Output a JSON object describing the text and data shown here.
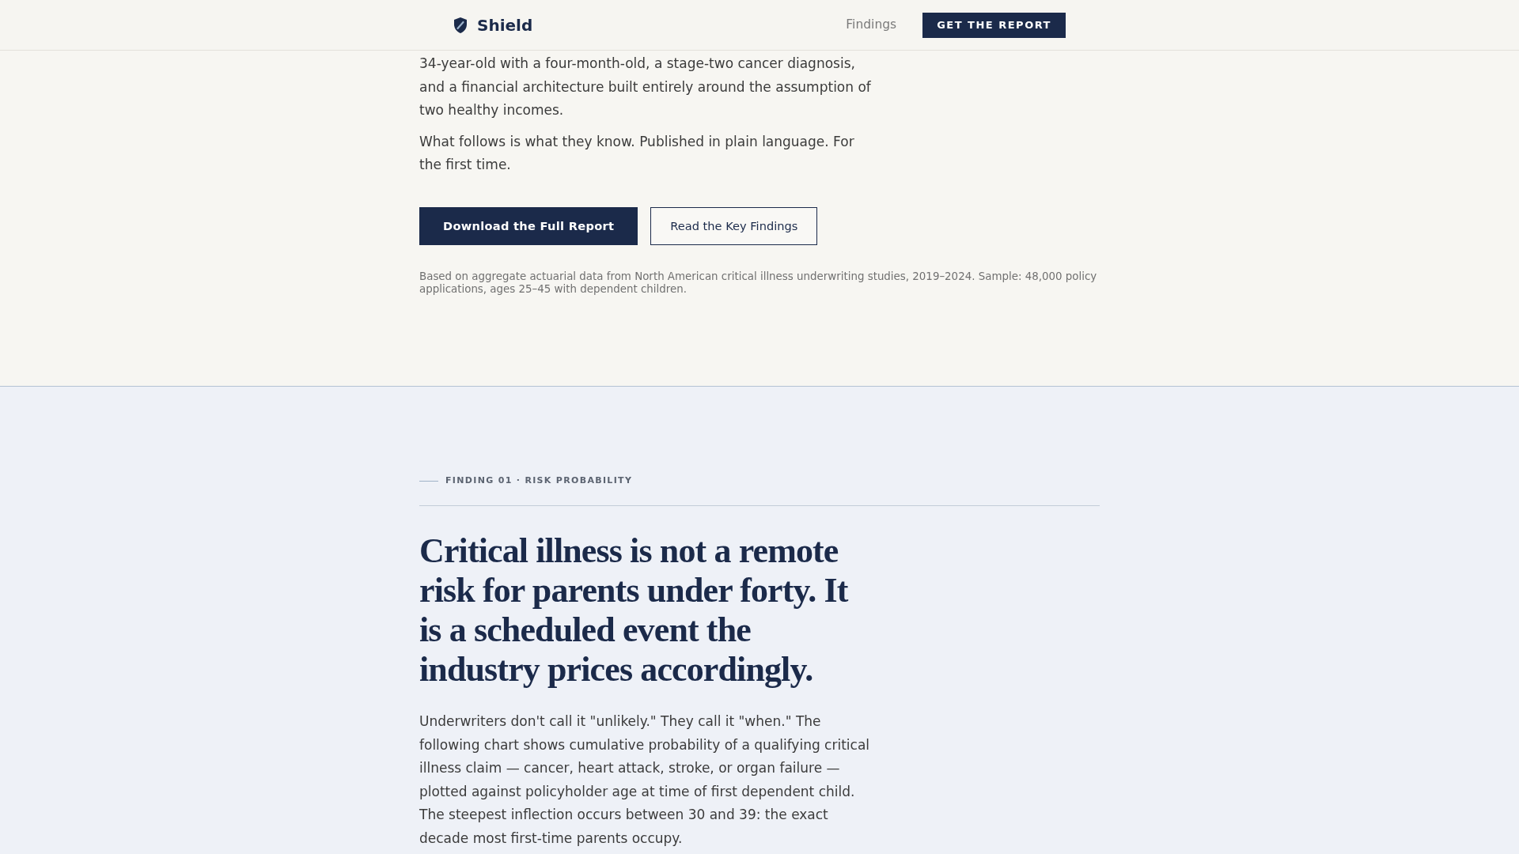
{
  "header": {
    "brand": "Shield",
    "nav": [
      {
        "label": "Findings"
      }
    ],
    "cta": "GET THE REPORT"
  },
  "hero": {
    "paragraphs": [
      "34-year-old with a four-month-old, a stage-two cancer diagnosis, and a financial architecture built entirely around the assumption of two healthy incomes.",
      "What follows is what they know. Published in plain language. For the first time."
    ],
    "buttons": [
      {
        "label": "Download the Full Report",
        "kind": "primary"
      },
      {
        "label": "Read the Key Findings",
        "kind": "secondary"
      }
    ],
    "footnote": "Based on aggregate actuarial data from North American critical illness underwriting studies, 2019–2024. Sample: 48,000 policy applications, ages 25–45 with dependent children."
  },
  "finding": {
    "eyebrow": "FINDING 01 · RISK PROBABILITY",
    "heading": "Critical illness is not a remote risk for parents under forty. It is a scheduled event the industry prices accordingly.",
    "body": "Underwriters don't call it \"unlikely.\" They call it \"when.\" The following chart shows cumulative probability of a qualifying critical illness claim — cancer, heart attack, stroke, or organ failure — plotted against policyholder age at time of first dependent child. The steepest inflection occurs between 30 and 39: the exact decade most first-time parents occupy."
  }
}
